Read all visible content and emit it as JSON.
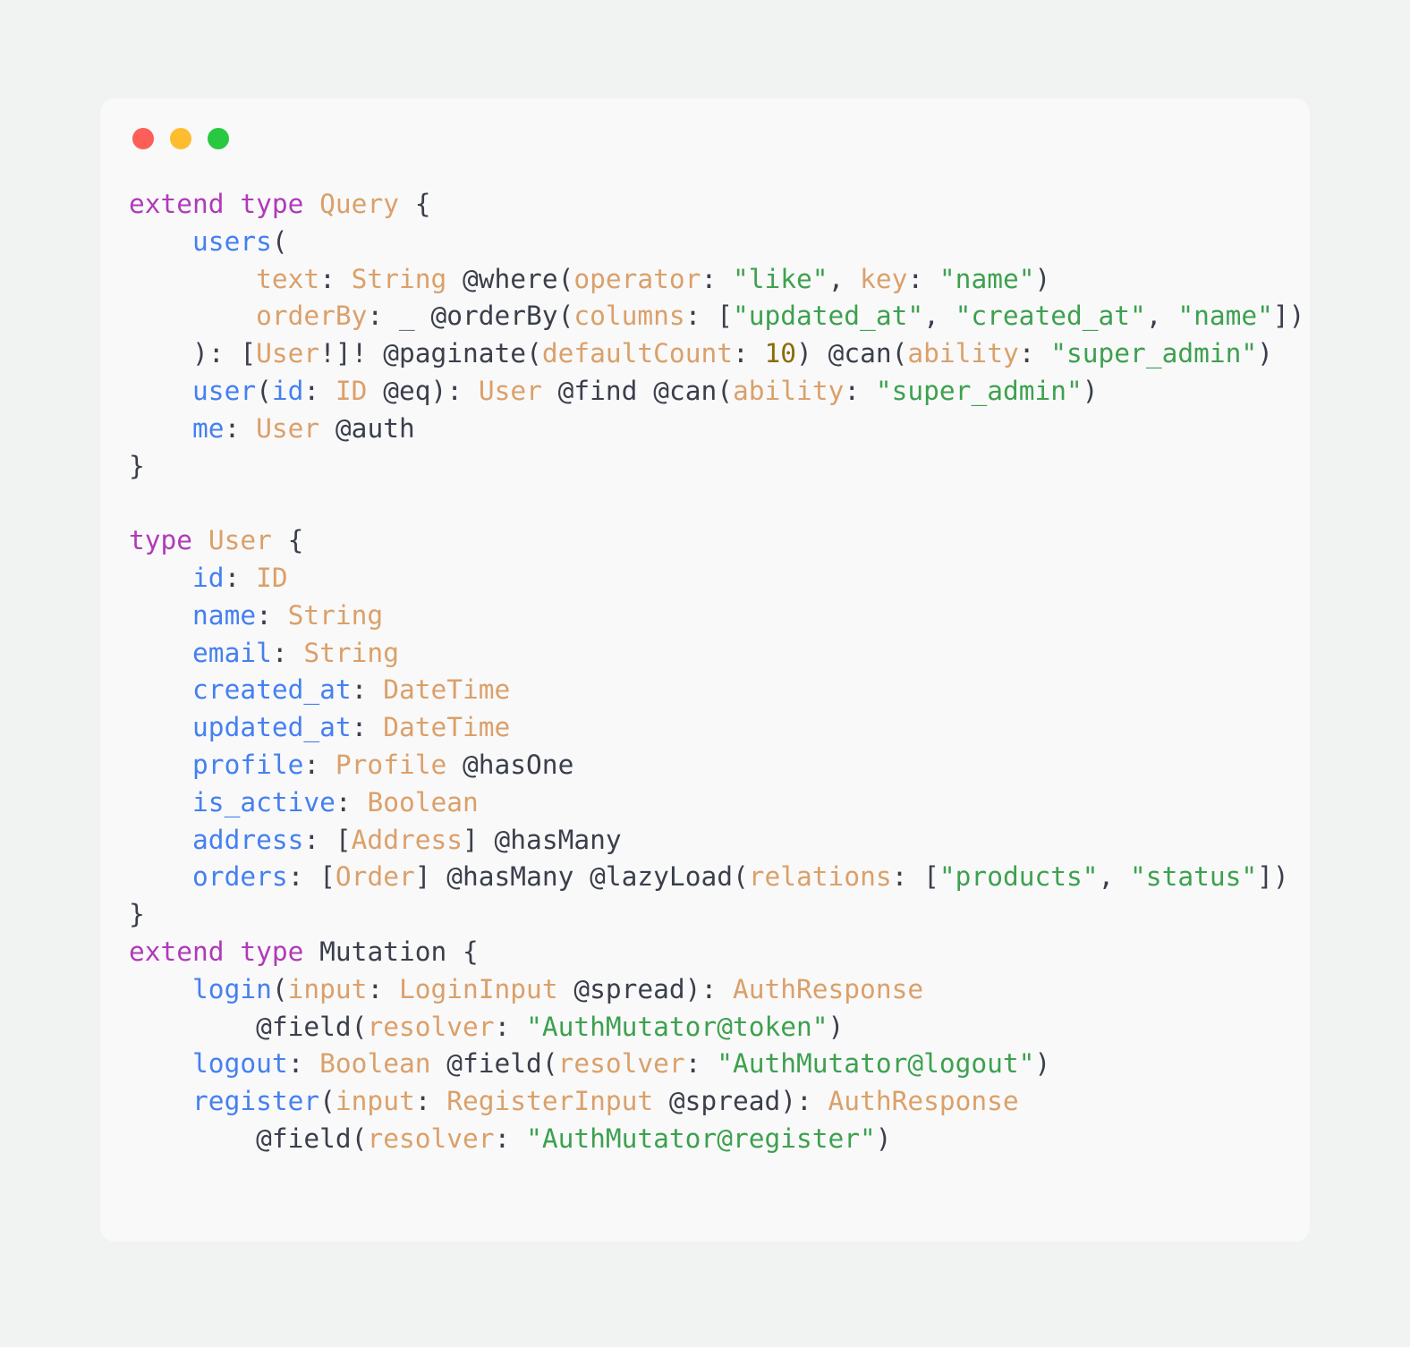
{
  "window": {
    "controls": [
      {
        "name": "close",
        "color": "#fb5f57"
      },
      {
        "name": "minimize",
        "color": "#febc2e"
      },
      {
        "name": "maximize",
        "color": "#28c840"
      }
    ]
  },
  "theme": {
    "page_background": "#f1f2f2",
    "card_background": "#f9f9fa",
    "keyword": "#b03ab8",
    "type": "#dba069",
    "field": "#4580f0",
    "argument": "#dba069",
    "directive": "#3a3f4b",
    "string": "#3da14e",
    "number": "#8a6d0b",
    "punctuation": "#3a3f4b"
  },
  "code": {
    "language": "graphql",
    "lines": [
      "extend type Query {",
      "    users(",
      "        text: String @where(operator: \"like\", key: \"name\")",
      "        orderBy: _ @orderBy(columns: [\"updated_at\", \"created_at\", \"name\"])",
      "    ): [User!]! @paginate(defaultCount: 10) @can(ability: \"super_admin\")",
      "    user(id: ID @eq): User @find @can(ability: \"super_admin\")",
      "    me: User @auth",
      "}",
      "",
      "type User {",
      "    id: ID",
      "    name: String",
      "    email: String",
      "    created_at: DateTime",
      "    updated_at: DateTime",
      "    profile: Profile @hasOne",
      "    is_active: Boolean",
      "    address: [Address] @hasMany",
      "    orders: [Order] @hasMany @lazyLoad(relations: [\"products\", \"status\"])",
      "}",
      "extend type Mutation {",
      "    login(input: LoginInput @spread): AuthResponse",
      "        @field(resolver: \"AuthMutator@token\")",
      "    logout: Boolean @field(resolver: \"AuthMutator@logout\")",
      "    register(input: RegisterInput @spread): AuthResponse",
      "        @field(resolver: \"AuthMutator@register\")"
    ],
    "tokens": {
      "keywords": [
        "extend",
        "type"
      ],
      "types": [
        "Query",
        "User",
        "String",
        "ID",
        "DateTime",
        "Profile",
        "Boolean",
        "Address",
        "Order",
        "LoginInput",
        "RegisterInput",
        "AuthResponse"
      ],
      "fields": [
        "users",
        "user",
        "me",
        "id",
        "name",
        "email",
        "created_at",
        "updated_at",
        "profile",
        "is_active",
        "address",
        "orders",
        "login",
        "logout",
        "register"
      ],
      "directives": [
        "@where",
        "@orderBy",
        "@paginate",
        "@can",
        "@eq",
        "@find",
        "@auth",
        "@hasOne",
        "@hasMany",
        "@lazyLoad",
        "@spread",
        "@field"
      ],
      "arguments": [
        "text",
        "orderBy",
        "operator",
        "key",
        "columns",
        "defaultCount",
        "ability",
        "relations",
        "input",
        "resolver"
      ],
      "strings": [
        "\"like\"",
        "\"name\"",
        "\"updated_at\"",
        "\"created_at\"",
        "\"super_admin\"",
        "\"products\"",
        "\"status\"",
        "\"AuthMutator@token\"",
        "\"AuthMutator@logout\"",
        "\"AuthMutator@register\""
      ],
      "numbers": [
        "10"
      ]
    }
  }
}
